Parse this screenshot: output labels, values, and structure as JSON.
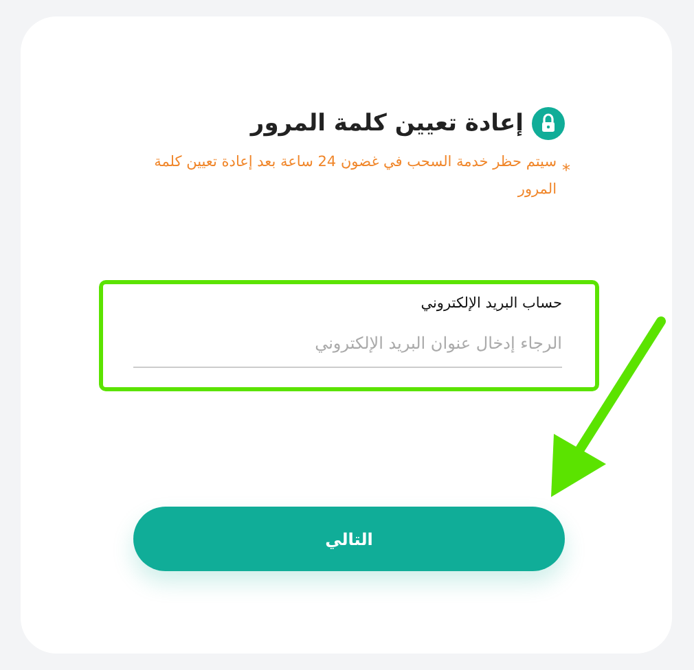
{
  "title": "إعادة تعيين كلمة المرور",
  "notice": {
    "marker": "*",
    "text": "سيتم حظر خدمة السحب في غضون 24 ساعة بعد إعادة تعيين كلمة المرور"
  },
  "email_field": {
    "label": "حساب البريد الإلكتروني",
    "placeholder": "الرجاء إدخال عنوان البريد الإلكتروني"
  },
  "next_button": "التالي"
}
